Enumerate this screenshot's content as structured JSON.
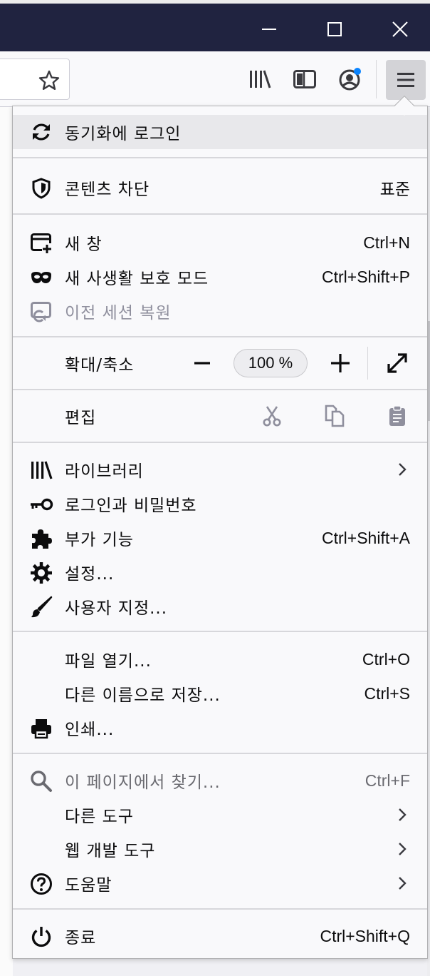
{
  "window": {
    "controls": [
      "minimize-icon",
      "maximize-icon",
      "close-icon"
    ]
  },
  "toolbar": {
    "icons": [
      "bookmark-star-icon",
      "library-icon",
      "sidebar-icon",
      "account-icon",
      "hamburger-menu-icon"
    ],
    "account_badge_color": "#0a84ff"
  },
  "menu": {
    "sync_label": "동기화에 로그인",
    "content_blocking": {
      "label": "콘텐츠 차단",
      "value": "표준"
    },
    "new_window": {
      "label": "새 창",
      "shortcut": "Ctrl+N"
    },
    "private_window": {
      "label": "새 사생활 보호 모드",
      "shortcut": "Ctrl+Shift+P"
    },
    "restore_session": {
      "label": "이전 세션 복원"
    },
    "zoom": {
      "label": "확대/축소",
      "minus": "−",
      "level": "100 %",
      "plus": "+"
    },
    "edit": {
      "label": "편집"
    },
    "library": {
      "label": "라이브러리"
    },
    "logins": {
      "label": "로그인과 비밀번호"
    },
    "addons": {
      "label": "부가 기능",
      "shortcut": "Ctrl+Shift+A"
    },
    "options": {
      "label": "설정..."
    },
    "customize": {
      "label": "사용자 지정..."
    },
    "open_file": {
      "label": "파일 열기...",
      "shortcut": "Ctrl+O"
    },
    "save_as": {
      "label": "다른 이름으로 저장...",
      "shortcut": "Ctrl+S"
    },
    "print": {
      "label": "인쇄..."
    },
    "find": {
      "label": "이 페이지에서 찾기...",
      "shortcut": "Ctrl+F"
    },
    "more_tools": {
      "label": "다른 도구"
    },
    "web_dev": {
      "label": "웹 개발 도구"
    },
    "help": {
      "label": "도움말"
    },
    "quit": {
      "label": "종료",
      "shortcut": "Ctrl+Shift+Q"
    }
  },
  "colors": {
    "titlebar": "#202340",
    "panel": "#f9f9fb",
    "disabled_text": "#8f8f9d"
  }
}
